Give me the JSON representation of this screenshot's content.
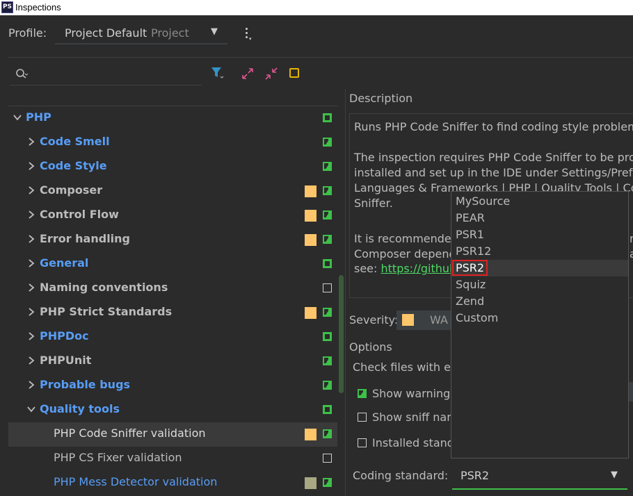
{
  "window": {
    "title": "Inspections",
    "app_icon_text": "PS"
  },
  "profile": {
    "label": "Profile:",
    "name": "Project Default",
    "type": "Project"
  },
  "toolbar": {
    "search_placeholder": ""
  },
  "tree": {
    "root": {
      "label": "PHP",
      "color": "blue",
      "expanded": true,
      "check": "on"
    },
    "items": [
      {
        "label": "Code Smell",
        "color": "blue",
        "severity": null,
        "check": "part"
      },
      {
        "label": "Code Style",
        "color": "blue",
        "severity": null,
        "check": "part"
      },
      {
        "label": "Composer",
        "color": "gray",
        "severity": "#ffc56a",
        "check": "part"
      },
      {
        "label": "Control Flow",
        "color": "gray",
        "severity": "#ffc56a",
        "check": "part"
      },
      {
        "label": "Error handling",
        "color": "gray",
        "severity": "#ffc56a",
        "check": "part"
      },
      {
        "label": "General",
        "color": "blue",
        "severity": null,
        "check": "on"
      },
      {
        "label": "Naming conventions",
        "color": "gray",
        "severity": null,
        "check": "off"
      },
      {
        "label": "PHP Strict Standards",
        "color": "gray",
        "severity": "#ffc56a",
        "check": "part"
      },
      {
        "label": "PHPDoc",
        "color": "blue",
        "severity": null,
        "check": "on"
      },
      {
        "label": "PHPUnit",
        "color": "gray",
        "severity": null,
        "check": "part"
      },
      {
        "label": "Probable bugs",
        "color": "blue",
        "severity": null,
        "check": "part"
      },
      {
        "label": "Quality tools",
        "color": "blue",
        "severity": null,
        "check": "on",
        "expanded": true
      }
    ],
    "leaves": [
      {
        "label": "PHP Code Sniffer validation",
        "color": "gray",
        "severity": "#ffc56a",
        "check": "part",
        "selected": true
      },
      {
        "label": "PHP CS Fixer validation",
        "color": "gray",
        "severity": null,
        "check": "off"
      },
      {
        "label": "PHP Mess Detector validation",
        "color": "blue",
        "severity": "#a8a882",
        "check": "part"
      }
    ]
  },
  "description": {
    "label": "Description",
    "lines": [
      "Runs PHP Code Sniffer to find coding style problems",
      "",
      "The inspection requires PHP Code Sniffer to be prop",
      "installed and set up in the IDE under Settings/Prefere",
      "Languages & Frameworks | PHP | Quality Tools | Cod",
      "Sniffer.",
      "",
      "It is recommended",
      "Composer depend"
    ],
    "see_prefix": "see: ",
    "link_text": "https://github",
    "right_fragments": [
      "r",
      "a"
    ]
  },
  "severity": {
    "label": "Severity:",
    "value": "WA",
    "color": "#ffc56a"
  },
  "options": {
    "label": "Options",
    "check_files_text": "Check files with ex",
    "show_warning": {
      "label": "Show warning",
      "checked": true
    },
    "show_sniff": {
      "label": "Show sniff nam",
      "checked": false
    },
    "installed": {
      "label": "Installed standa",
      "checked": false
    }
  },
  "coding_standard": {
    "label": "Coding standard:",
    "value": "PSR2"
  },
  "popup": {
    "items": [
      "MySource",
      "PEAR",
      "PSR1",
      "PSR12",
      "PSR2",
      "Squiz",
      "Zend",
      "Custom"
    ],
    "highlighted": "PSR2"
  },
  "colors": {
    "accent_blue": "#589df6",
    "check_green": "#3ec04a",
    "link_green": "#4cd964",
    "warning": "#ffc56a"
  }
}
